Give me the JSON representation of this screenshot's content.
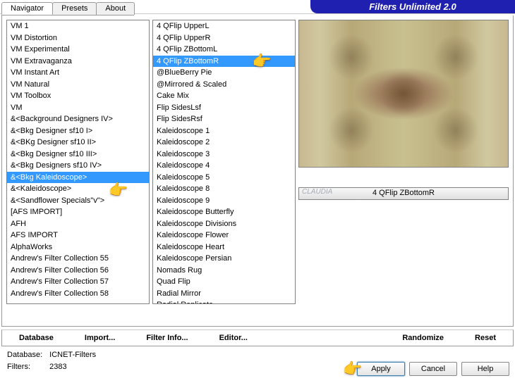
{
  "app_title": "Filters Unlimited 2.0",
  "tabs": [
    "Navigator",
    "Presets",
    "About"
  ],
  "active_tab": "Navigator",
  "left_list": [
    "VM 1",
    "VM Distortion",
    "VM Experimental",
    "VM Extravaganza",
    "VM Instant Art",
    "VM Natural",
    "VM Toolbox",
    "VM",
    "&<Background Designers IV>",
    "&<Bkg Designer sf10 I>",
    "&<BKg Designer sf10 II>",
    "&<Bkg Designer sf10 III>",
    "&<Bkg Designers sf10 IV>",
    "&<Bkg Kaleidoscope>",
    "&<Kaleidoscope>",
    "&<Sandflower Specials\"v\">",
    "[AFS IMPORT]",
    "AFH",
    "AFS IMPORT",
    "AlphaWorks",
    "Andrew's Filter Collection 55",
    "Andrew's Filter Collection 56",
    "Andrew's Filter Collection 57",
    "Andrew's Filter Collection 58"
  ],
  "left_list_selected_index": 13,
  "mid_list": [
    "4 QFlip UpperL",
    "4 QFlip UpperR",
    "4 QFlip ZBottomL",
    "4 QFlip ZBottomR",
    "@BlueBerry Pie",
    "@Mirrored & Scaled",
    "Cake Mix",
    "Flip SidesLsf",
    "Flip SidesRsf",
    "Kaleidoscope 1",
    "Kaleidoscope 2",
    "Kaleidoscope 3",
    "Kaleidoscope 4",
    "Kaleidoscope 5",
    "Kaleidoscope 8",
    "Kaleidoscope 9",
    "Kaleidoscope Butterfly",
    "Kaleidoscope Divisions",
    "Kaleidoscope Flower",
    "Kaleidoscope Heart",
    "Kaleidoscope Persian",
    "Nomads Rug",
    "Quad Flip",
    "Radial Mirror",
    "Radial Replicate"
  ],
  "mid_list_selected_index": 3,
  "preview_label": "4 QFlip ZBottomR",
  "watermark": "CLAUDIA",
  "toolbar": {
    "database": "Database",
    "import": "Import...",
    "filter_info": "Filter Info...",
    "editor": "Editor...",
    "randomize": "Randomize",
    "reset": "Reset"
  },
  "status": {
    "database_label": "Database:",
    "database_value": "ICNET-Filters",
    "filters_label": "Filters:",
    "filters_value": "2383"
  },
  "buttons": {
    "apply": "Apply",
    "cancel": "Cancel",
    "help": "Help"
  }
}
